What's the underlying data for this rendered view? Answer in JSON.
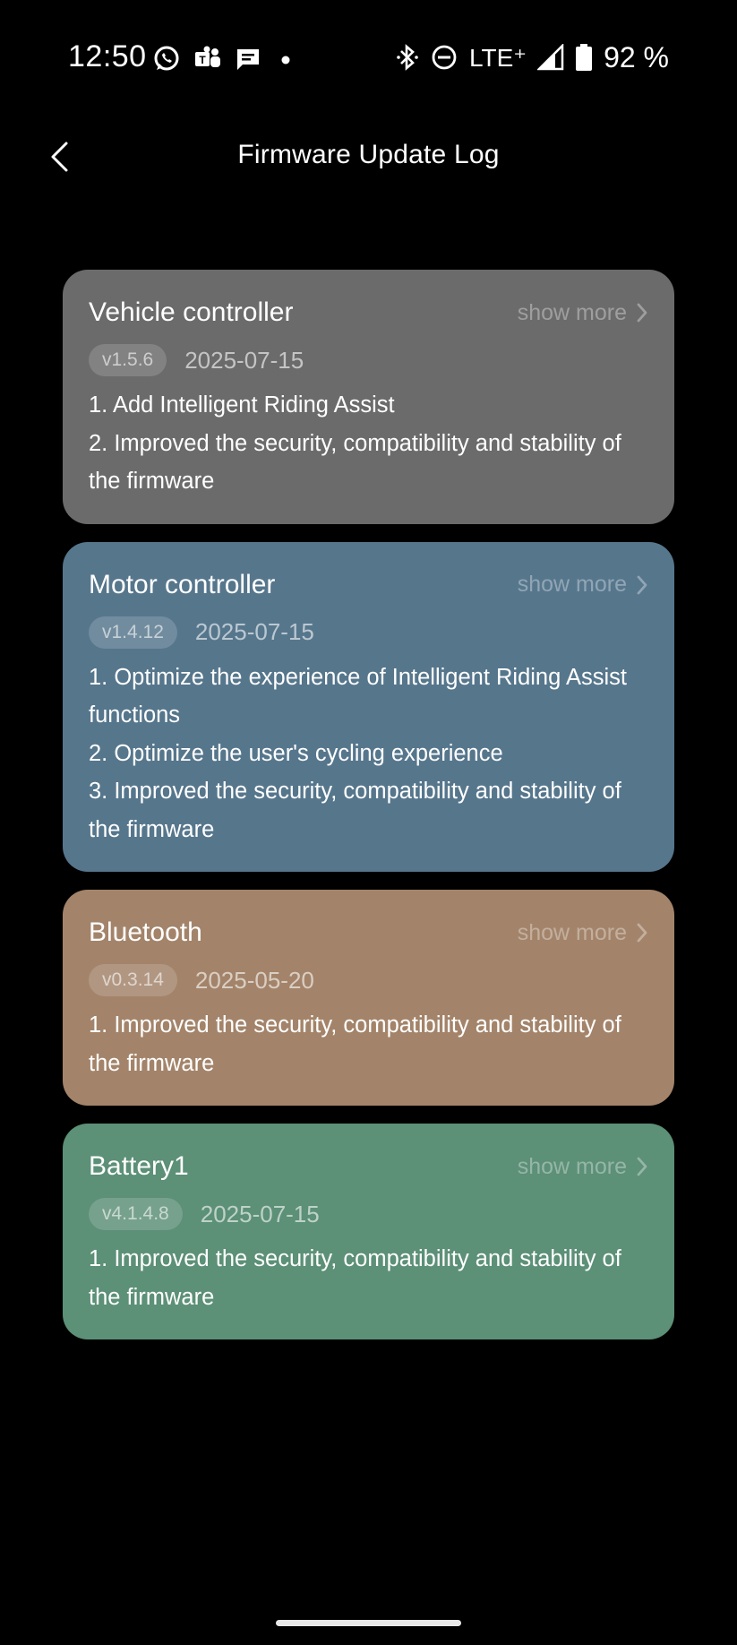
{
  "status_bar": {
    "time": "12:50",
    "network": "LTE⁺",
    "battery_percent": "92 %",
    "left_icons": [
      "whatsapp-icon",
      "teams-icon",
      "messages-icon",
      "dot-icon"
    ],
    "right_icons": [
      "bluetooth-icon",
      "dnd-icon",
      "signal-icon",
      "battery-icon"
    ]
  },
  "header": {
    "title": "Firmware Update Log",
    "back_icon": "chevron-left-icon"
  },
  "cards": [
    {
      "title": "Vehicle controller",
      "show_more": "show more",
      "version": "v1.5.6",
      "date": "2025-07-15",
      "color": "#6b6b6b",
      "notes": [
        "1. Add Intelligent Riding Assist",
        "2. Improved the security, compatibility and stability of the firmware"
      ]
    },
    {
      "title": "Motor controller",
      "show_more": "show more",
      "version": "v1.4.12",
      "date": "2025-07-15",
      "color": "#56768c",
      "notes": [
        "1. Optimize the experience of Intelligent Riding Assist functions",
        "2. Optimize the user's cycling experience",
        "3. Improved the security, compatibility and stability of the firmware"
      ]
    },
    {
      "title": "Bluetooth",
      "show_more": "show more",
      "version": "v0.3.14",
      "date": "2025-05-20",
      "color": "#a3846a",
      "notes": [
        "1. Improved the security, compatibility and stability of the firmware"
      ]
    },
    {
      "title": "Battery1",
      "show_more": "show more",
      "version": "v4.1.4.8",
      "date": "2025-07-15",
      "color": "#5c9077",
      "notes": [
        "1. Improved the security, compatibility and stability of the firmware"
      ]
    }
  ]
}
